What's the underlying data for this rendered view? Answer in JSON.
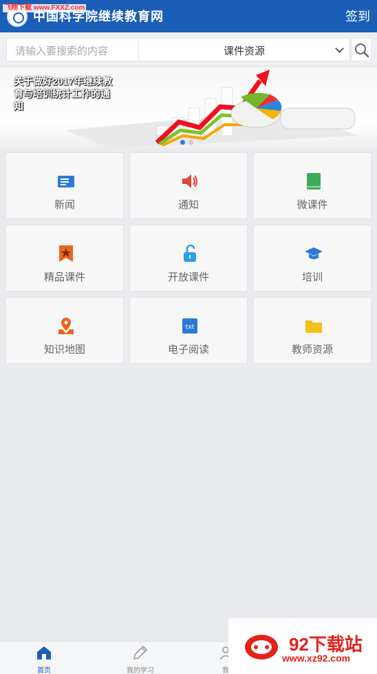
{
  "header": {
    "title": "中国科学院继续教育网",
    "signin_label": "签到",
    "watermark": "飞翔下载 www.FXXZ.com"
  },
  "search": {
    "placeholder": "请输入要搜索的内容",
    "category": "课件资源"
  },
  "banner": {
    "caption": "关于做好2017年继续教育与培训统计工作的通知",
    "slide_count": 2,
    "active_slide": 1
  },
  "grid": [
    {
      "label": "新闻",
      "icon": "news-icon",
      "color": "#2b7bd6"
    },
    {
      "label": "通知",
      "icon": "speaker-icon",
      "color": "#e2473b"
    },
    {
      "label": "微课件",
      "icon": "book-icon",
      "color": "#3dac56"
    },
    {
      "label": "精品课件",
      "icon": "bookmark-star-icon",
      "color": "#e8661f"
    },
    {
      "label": "开放课件",
      "icon": "unlock-icon",
      "color": "#2c9ee3"
    },
    {
      "label": "培训",
      "icon": "graduation-cap-icon",
      "color": "#2b7bd6"
    },
    {
      "label": "知识地图",
      "icon": "map-pin-icon",
      "color": "#e8661f"
    },
    {
      "label": "电子阅读",
      "icon": "txt-file-icon",
      "color": "#2b7bd6"
    },
    {
      "label": "教师资源",
      "icon": "folder-icon",
      "color": "#f2c21b"
    }
  ],
  "bottom_nav": [
    {
      "label": "首页",
      "icon": "home-icon",
      "active": true
    },
    {
      "label": "我的学习",
      "icon": "pencil-icon",
      "active": false
    },
    {
      "label": "我",
      "icon": "user-icon",
      "active": false
    }
  ],
  "watermark_br": {
    "title": "92下载站",
    "url": "www.xz92.com"
  }
}
